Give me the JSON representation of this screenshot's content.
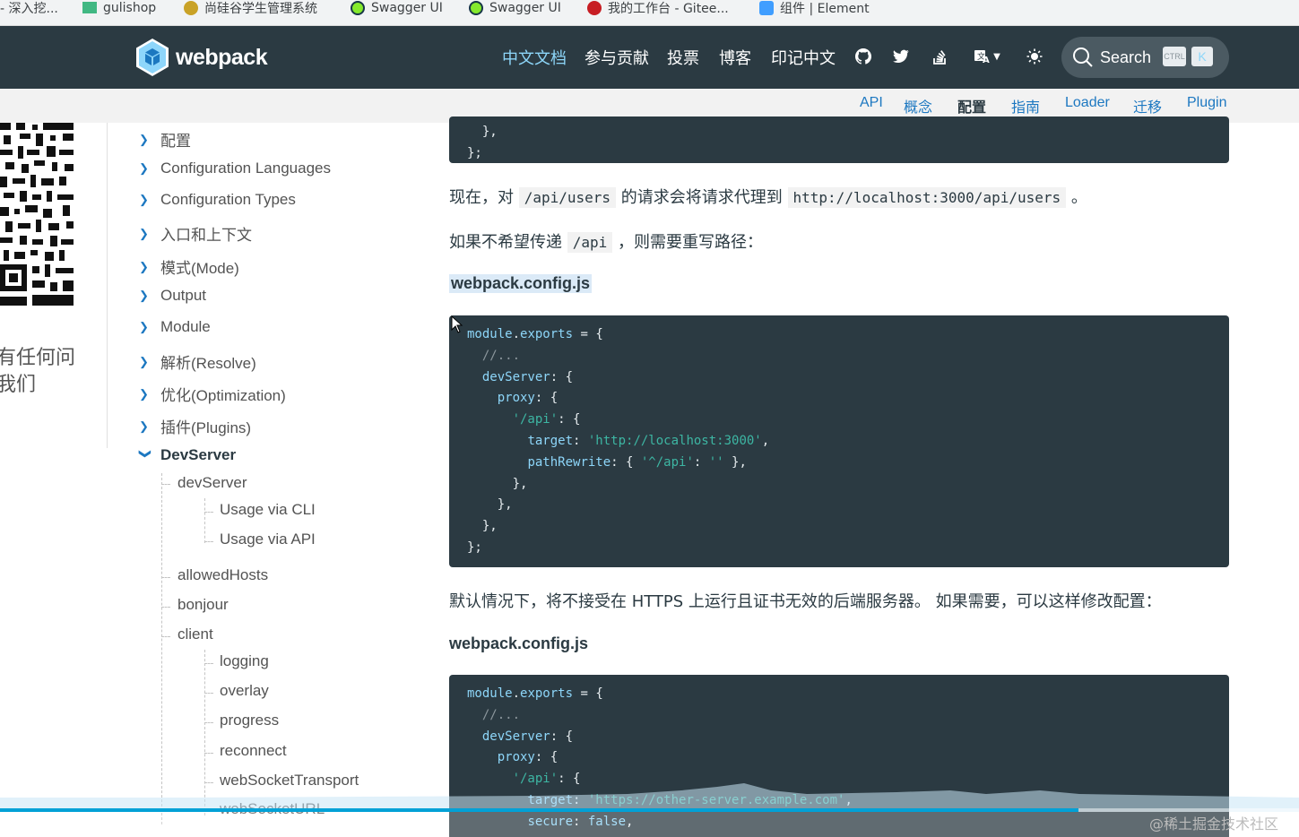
{
  "bookmarks": [
    {
      "label": "- 深入挖...",
      "color": "#e0e0e0"
    },
    {
      "label": "gulishop",
      "color": "#41b883"
    },
    {
      "label": "尚硅谷学生管理系统",
      "color": "#c9a227"
    },
    {
      "label": "Swagger UI",
      "color": "#85ea2d"
    },
    {
      "label": "Swagger UI",
      "color": "#85ea2d"
    },
    {
      "label": "我的工作台 - Gitee...",
      "color": "#c71d23"
    },
    {
      "label": "组件 | Element",
      "color": "#409eff"
    }
  ],
  "header": {
    "logo_text": "webpack",
    "nav": [
      "中文文档",
      "参与贡献",
      "投票",
      "博客",
      "印记中文"
    ],
    "icons": [
      "github-icon",
      "twitter-icon",
      "stackoverflow-icon",
      "language-icon",
      "theme-toggle-icon"
    ],
    "search": {
      "label": "Search",
      "shortcut_ctrl": "CTRL",
      "shortcut_key": "K"
    }
  },
  "subnav": [
    "API",
    "概念",
    "配置",
    "指南",
    "Loader",
    "迁移",
    "Plugin"
  ],
  "left_fragment": {
    "line1": "有任何问",
    "line2": "我们"
  },
  "sidebar": {
    "items": [
      "配置",
      "Configuration Languages",
      "Configuration Types",
      "入口和上下文",
      "模式(Mode)",
      "Output",
      "Module",
      "解析(Resolve)",
      "优化(Optimization)",
      "插件(Plugins)"
    ],
    "open_item": "DevServer",
    "children": {
      "devserver": "devServer",
      "devserver_sub": [
        "Usage via CLI",
        "Usage via API"
      ],
      "allowed": "allowedHosts",
      "bonjour": "bonjour",
      "client": "client",
      "client_sub": [
        "logging",
        "overlay",
        "progress",
        "reconnect",
        "webSocketTransport",
        "webSocketURL"
      ]
    }
  },
  "content": {
    "top_code_tail": [
      "  },",
      "};"
    ],
    "p1": {
      "before": "现在，对 ",
      "code1": "/api/users",
      "middle": " 的请求会将请求代理到 ",
      "code2": "http://localhost:3000/api/users",
      "after": " 。"
    },
    "p2": {
      "before": "如果不希望传递 ",
      "code": "/api",
      "after": " ，则需要重写路径："
    },
    "filename1": "webpack.config.js",
    "p3": "默认情况下，将不接受在 HTTPS 上运行且证书无效的后端服务器。 如果需要，可以这样修改配置：",
    "filename2": "webpack.config.js"
  },
  "watermark": "@稀土掘金技术社区",
  "video_progress_percent": 83
}
